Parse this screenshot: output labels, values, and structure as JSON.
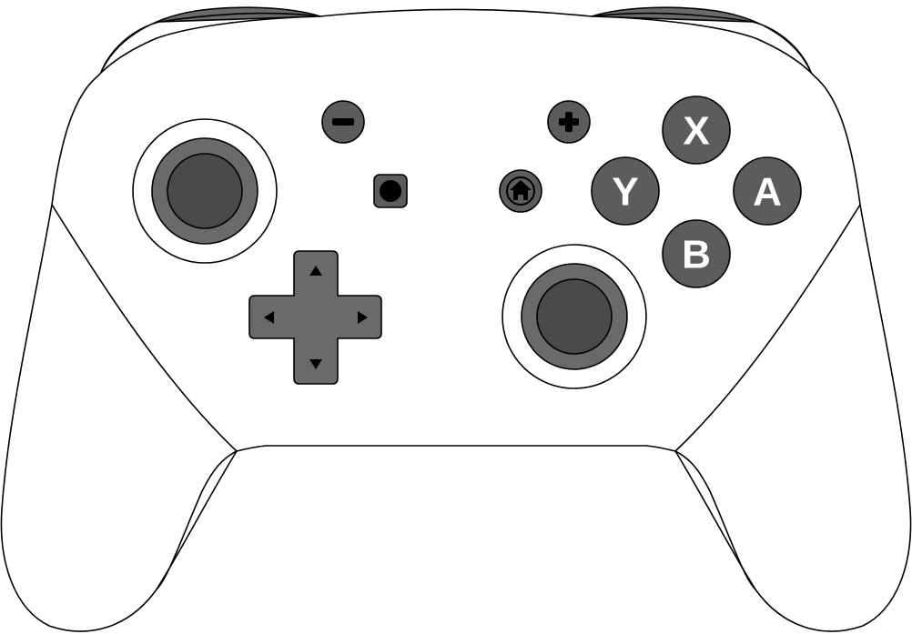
{
  "controller": {
    "face_buttons": {
      "x": "X",
      "a": "A",
      "y": "Y",
      "b": "B"
    }
  },
  "colors": {
    "shell": "#ffffff",
    "outline": "#000000",
    "bumper": "#6a6a6a",
    "button": "#5c5c5c",
    "stick_ring": "#6a6a6a",
    "stick_cap": "#4a4a4a",
    "label": "#ffffff"
  },
  "icons": {
    "minus_button": "minus-icon",
    "plus_button": "plus-icon",
    "capture_button": "capture-dot-icon",
    "home_button": "home-icon",
    "dpad": [
      "arrow-up-icon",
      "arrow-down-icon",
      "arrow-left-icon",
      "arrow-right-icon"
    ]
  }
}
